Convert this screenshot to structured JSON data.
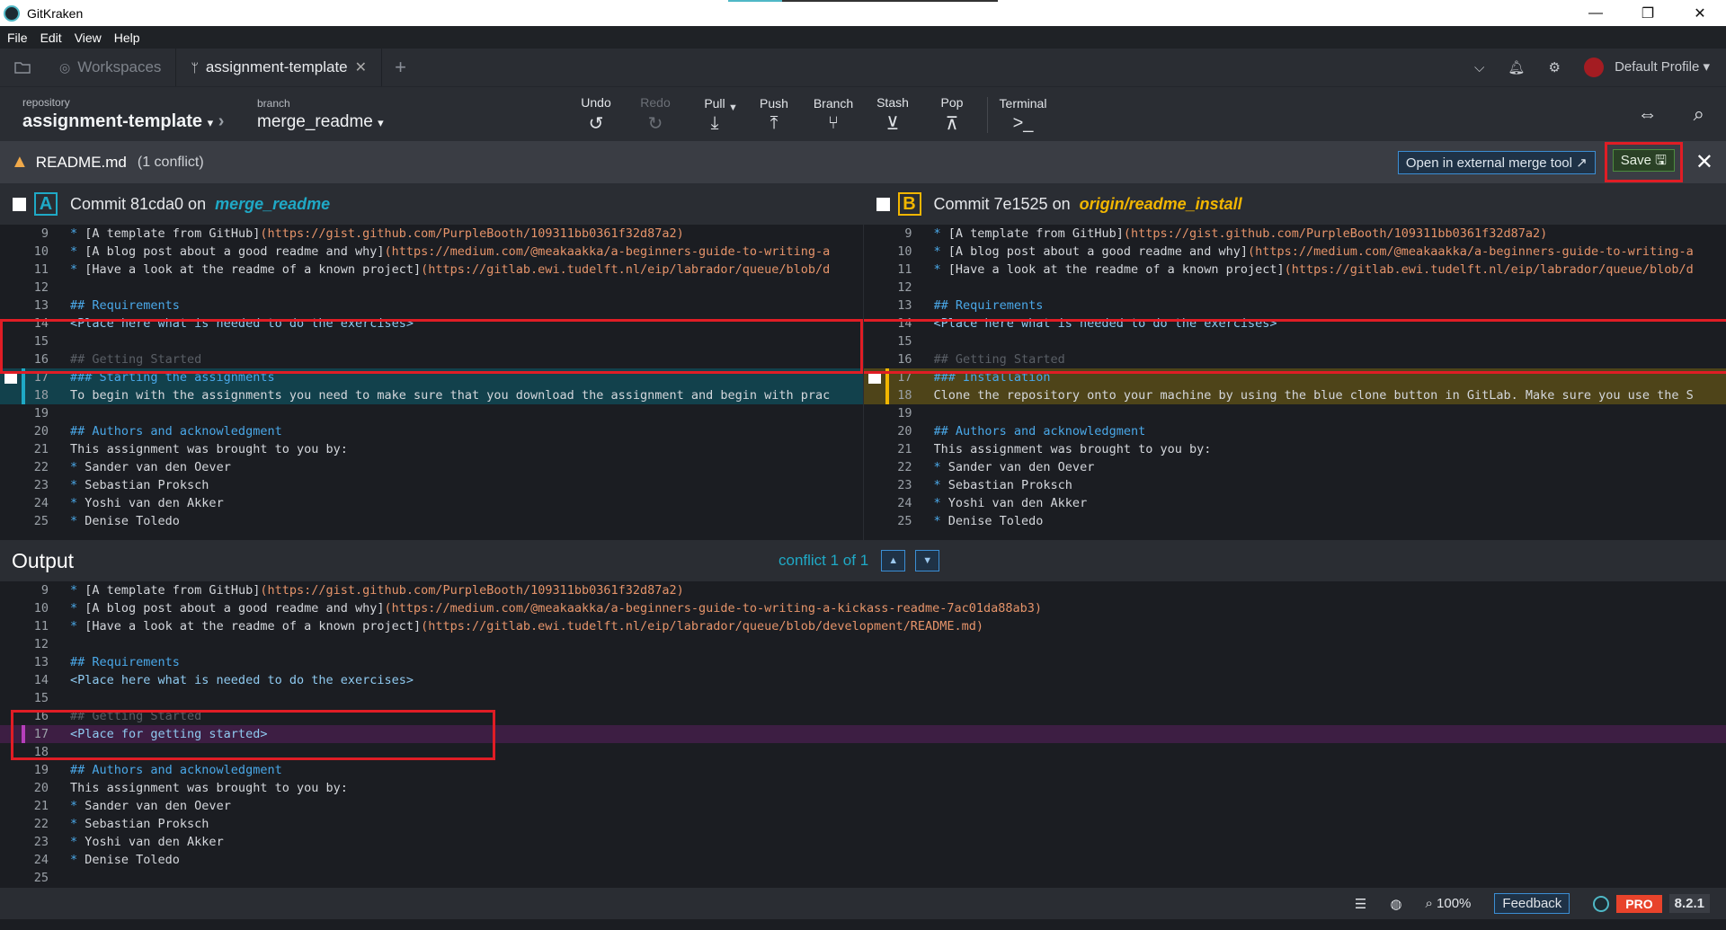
{
  "window": {
    "title": "GitKraken",
    "minimize": "—",
    "restore": "❐",
    "close": "✕"
  },
  "menu": [
    "File",
    "Edit",
    "View",
    "Help"
  ],
  "tabs": {
    "workspaces": "Workspaces",
    "active": "assignment-template",
    "plus": "+"
  },
  "header_right": {
    "profile": "Default Profile"
  },
  "toolbar": {
    "repo_label": "repository",
    "repo_name": "assignment-template",
    "branch_label": "branch",
    "branch_name": "merge_readme",
    "undo": "Undo",
    "redo": "Redo",
    "pull": "Pull",
    "push": "Push",
    "branch": "Branch",
    "stash": "Stash",
    "pop": "Pop",
    "terminal": "Terminal"
  },
  "conflict": {
    "file": "README.md",
    "count": "(1 conflict)",
    "external": "Open in external merge tool",
    "save": "Save"
  },
  "pane_a": {
    "prefix": "Commit 81cda0 on",
    "branch": "merge_readme",
    "badge": "A"
  },
  "pane_b": {
    "prefix": "Commit 7e1525 on",
    "branch": "origin/readme_install",
    "badge": "B"
  },
  "lines_a": [
    {
      "n": "9",
      "t": "* [A template from GitHub](https://gist.github.com/PurpleBooth/109311bb0361f32d87a2)"
    },
    {
      "n": "10",
      "t": "* [A blog post about a good readme and why](https://medium.com/@meakaakka/a-beginners-guide-to-writing-a"
    },
    {
      "n": "11",
      "t": "* [Have a look at the readme of a known project](https://gitlab.ewi.tudelft.nl/eip/labrador/queue/blob/d"
    },
    {
      "n": "12",
      "t": ""
    },
    {
      "n": "13",
      "t": "## Requirements"
    },
    {
      "n": "14",
      "t": "<Place here what is needed to do the exercises>"
    },
    {
      "n": "15",
      "t": ""
    },
    {
      "n": "16",
      "t": "## Getting Started"
    },
    {
      "n": "17",
      "t": "### Starting the assignments"
    },
    {
      "n": "18",
      "t": "To begin with the assignments you need to make sure that you download the assignment and begin with prac"
    },
    {
      "n": "19",
      "t": ""
    },
    {
      "n": "20",
      "t": "## Authors and acknowledgment"
    },
    {
      "n": "21",
      "t": "This assignment was brought to you by:"
    },
    {
      "n": "22",
      "t": "* Sander van den Oever"
    },
    {
      "n": "23",
      "t": "* Sebastian Proksch"
    },
    {
      "n": "24",
      "t": "* Yoshi van den Akker"
    },
    {
      "n": "25",
      "t": "* Denise Toledo"
    }
  ],
  "lines_b": [
    {
      "n": "9",
      "t": "* [A template from GitHub](https://gist.github.com/PurpleBooth/109311bb0361f32d87a2)"
    },
    {
      "n": "10",
      "t": "* [A blog post about a good readme and why](https://medium.com/@meakaakka/a-beginners-guide-to-writing-a"
    },
    {
      "n": "11",
      "t": "* [Have a look at the readme of a known project](https://gitlab.ewi.tudelft.nl/eip/labrador/queue/blob/d"
    },
    {
      "n": "12",
      "t": ""
    },
    {
      "n": "13",
      "t": "## Requirements"
    },
    {
      "n": "14",
      "t": "<Place here what is needed to do the exercises>"
    },
    {
      "n": "15",
      "t": ""
    },
    {
      "n": "16",
      "t": "## Getting Started"
    },
    {
      "n": "17",
      "t": "### Installation"
    },
    {
      "n": "18",
      "t": "Clone the repository onto your machine by using the blue clone button in GitLab. Make sure you use the S"
    },
    {
      "n": "19",
      "t": ""
    },
    {
      "n": "20",
      "t": "## Authors and acknowledgment"
    },
    {
      "n": "21",
      "t": "This assignment was brought to you by:"
    },
    {
      "n": "22",
      "t": "* Sander van den Oever"
    },
    {
      "n": "23",
      "t": "* Sebastian Proksch"
    },
    {
      "n": "24",
      "t": "* Yoshi van den Akker"
    },
    {
      "n": "25",
      "t": "* Denise Toledo"
    }
  ],
  "output": {
    "title": "Output",
    "conflict_nav": "conflict 1 of 1",
    "up": "▲",
    "down": "▼",
    "lines": [
      {
        "n": "9",
        "t": "* [A template from GitHub](https://gist.github.com/PurpleBooth/109311bb0361f32d87a2)"
      },
      {
        "n": "10",
        "t": "* [A blog post about a good readme and why](https://medium.com/@meakaakka/a-beginners-guide-to-writing-a-kickass-readme-7ac01da88ab3)"
      },
      {
        "n": "11",
        "t": "* [Have a look at the readme of a known project](https://gitlab.ewi.tudelft.nl/eip/labrador/queue/blob/development/README.md)"
      },
      {
        "n": "12",
        "t": ""
      },
      {
        "n": "13",
        "t": "## Requirements"
      },
      {
        "n": "14",
        "t": "<Place here what is needed to do the exercises>"
      },
      {
        "n": "15",
        "t": ""
      },
      {
        "n": "16",
        "t": "## Getting Started"
      },
      {
        "n": "17",
        "t": "<Place for getting started>"
      },
      {
        "n": "18",
        "t": ""
      },
      {
        "n": "19",
        "t": "## Authors and acknowledgment"
      },
      {
        "n": "20",
        "t": "This assignment was brought to you by:"
      },
      {
        "n": "21",
        "t": "* Sander van den Oever"
      },
      {
        "n": "22",
        "t": "* Sebastian Proksch"
      },
      {
        "n": "23",
        "t": "* Yoshi van den Akker"
      },
      {
        "n": "24",
        "t": "* Denise Toledo"
      },
      {
        "n": "25",
        "t": ""
      }
    ]
  },
  "status": {
    "zoom": "100%",
    "feedback": "Feedback",
    "pro": "PRO",
    "version": "8.2.1"
  },
  "colors": {
    "accent_a": "#1fa9c6",
    "accent_b": "#f2b600",
    "output_mark": "#b63fbb",
    "highlight_box": "#e01d25"
  }
}
